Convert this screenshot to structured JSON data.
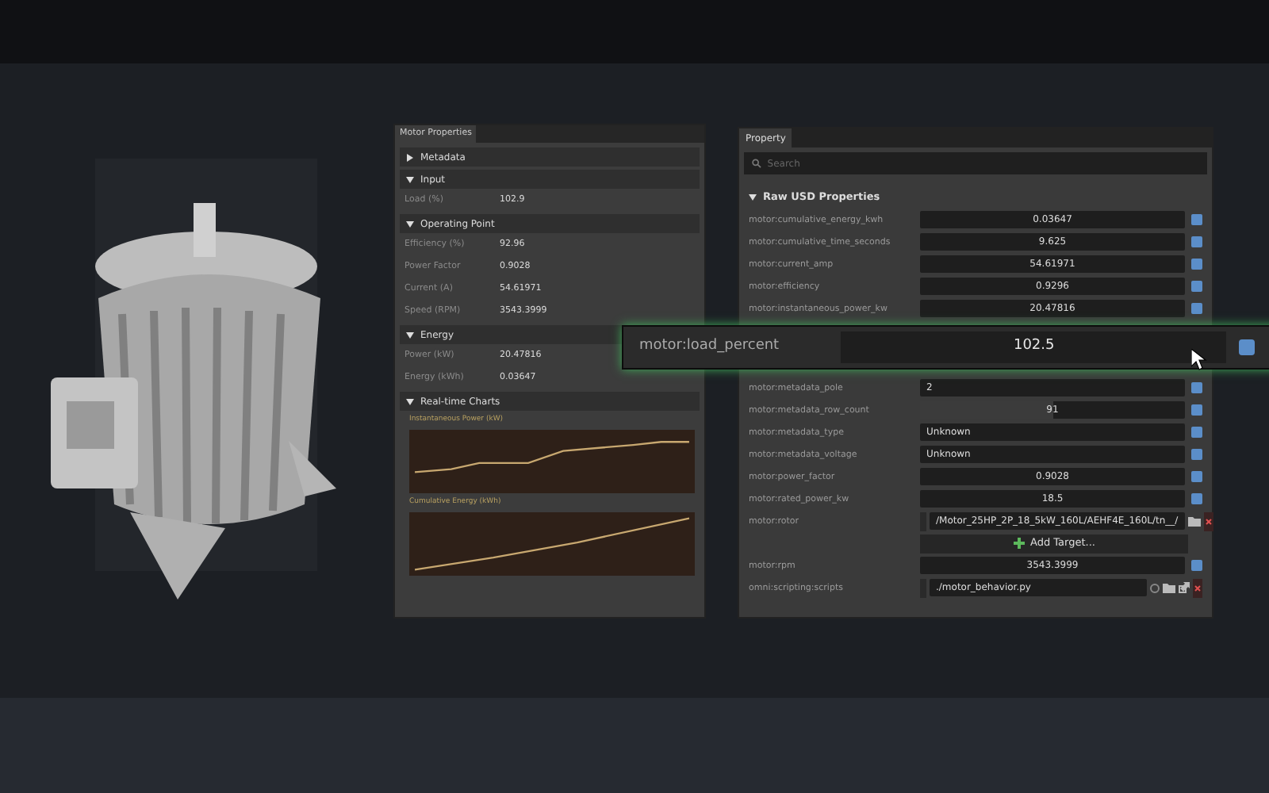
{
  "motor_panel": {
    "tab": "Motor Properties",
    "sections": [
      {
        "title": "Metadata",
        "expanded": false
      },
      {
        "title": "Input",
        "expanded": true,
        "fields": [
          {
            "label": "Load (%)",
            "value": "102.9"
          }
        ]
      },
      {
        "title": "Operating Point",
        "expanded": true,
        "fields": [
          {
            "label": "Efficiency (%)",
            "value": "92.96"
          },
          {
            "label": "Power Factor",
            "value": "0.9028"
          },
          {
            "label": "Current (A)",
            "value": "54.61971"
          },
          {
            "label": "Speed (RPM)",
            "value": "3543.3999"
          }
        ]
      },
      {
        "title": "Energy",
        "expanded": true,
        "fields": [
          {
            "label": "Power (kW)",
            "value": "20.47816"
          },
          {
            "label": "Energy (kWh)",
            "value": "0.03647"
          }
        ]
      },
      {
        "title": "Real-time Charts",
        "expanded": true
      }
    ],
    "charts": [
      {
        "title": "Instantaneous Power (kW)",
        "kind": "step"
      },
      {
        "title": "Cumulative Energy (kWh)",
        "kind": "rising"
      }
    ]
  },
  "property_panel": {
    "tab": "Property",
    "search": {
      "placeholder": "Search"
    },
    "section": {
      "title": "Raw USD Properties",
      "expanded": true
    },
    "rows_above": [
      {
        "kind": "number",
        "label": "motor:cumulative_energy_kwh",
        "value": "0.03647",
        "checked": true
      },
      {
        "kind": "number",
        "label": "motor:cumulative_time_seconds",
        "value": "9.625",
        "checked": true
      },
      {
        "kind": "number",
        "label": "motor:current_amp",
        "value": "54.61971",
        "checked": true
      },
      {
        "kind": "number",
        "label": "motor:efficiency",
        "value": "0.9296",
        "checked": true
      },
      {
        "kind": "number",
        "label": "motor:instantaneous_power_kw",
        "value": "20.47816",
        "checked": true
      }
    ],
    "rows_below": [
      {
        "kind": "text",
        "label": "motor:metadata_pole",
        "value": "2",
        "checked": true
      },
      {
        "kind": "slider",
        "label": "motor:metadata_row_count",
        "value": "91",
        "level": 0.5,
        "checked": true
      },
      {
        "kind": "text",
        "label": "motor:metadata_type",
        "value": "Unknown",
        "checked": true
      },
      {
        "kind": "text",
        "label": "motor:metadata_voltage",
        "value": "Unknown",
        "checked": true
      },
      {
        "kind": "number",
        "label": "motor:power_factor",
        "value": "0.9028",
        "checked": true
      },
      {
        "kind": "number",
        "label": "motor:rated_power_kw",
        "value": "18.5",
        "checked": true
      },
      {
        "kind": "path",
        "label": "motor:rotor",
        "value": "/Motor_25HP_2P_18_5kW_160L/AEHF4E_160L/tn__/"
      },
      {
        "kind": "add",
        "value": "Add Target..."
      },
      {
        "kind": "number",
        "label": "motor:rpm",
        "value": "3543.3999",
        "checked": true
      },
      {
        "kind": "script",
        "label": "omni:scripting:scripts",
        "value": "./motor_behavior.py"
      }
    ]
  },
  "floating_row": {
    "label": "motor:load_percent",
    "value": "102.5",
    "checked": true
  }
}
